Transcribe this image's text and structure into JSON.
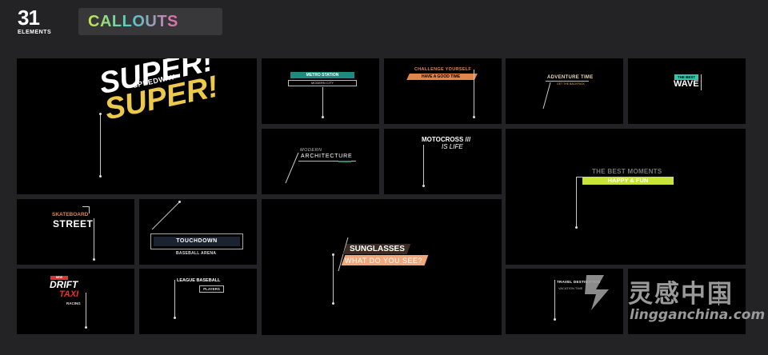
{
  "header": {
    "count": "31",
    "count_label": "ELEMENTS",
    "category": "CALLOUTS"
  },
  "callouts": {
    "super": {
      "top": "SUPER!",
      "middle": "SPEEDWAY",
      "bottom": "SUPER!"
    },
    "metro": {
      "title": "METRO STATION",
      "sub": "MODERN CITY"
    },
    "challenge": {
      "title": "CHALLENGE YOURSELF",
      "sub": "HAVE A GOOD TIME"
    },
    "adventure": {
      "title": "ADVENTURE TIME",
      "sub": "GET THE BACKPACK"
    },
    "wave": {
      "top": "THE BEST",
      "bottom": "WAVE"
    },
    "modern": {
      "top": "MODERN",
      "bottom": "ARCHITECTURE"
    },
    "motocross": {
      "top": "MOTOCROSS ///",
      "bottom": "IS LIFE"
    },
    "moments": {
      "top": "THE BEST MOMENTS",
      "bottom": "HAPPY & FUN"
    },
    "skateboard": {
      "top": "SKATEBOARD",
      "bottom": "STREET"
    },
    "touchdown": {
      "title": "TOUCHDOWN",
      "sub": "BASEBALL ARENA"
    },
    "sunglasses": {
      "top": "SUNGLASSES",
      "bottom": "WHAT DO YOU SEE?"
    },
    "drift": {
      "tag": "NEW",
      "top": "DRIFT",
      "middle": "TAXI",
      "bottom": "RACING"
    },
    "baseball": {
      "top": "LEAGUE BASEBALL",
      "bottom": "PLAYERS"
    },
    "travel": {
      "top": "TRAVEL DESTINATION",
      "bottom": "VACATION TIME"
    }
  },
  "watermark": {
    "cn": "灵感中国",
    "en": "lingganchina.com"
  },
  "colors": {
    "teal": "#1f8a7e",
    "yellow": "#ecc94b",
    "lime": "#c8e33a",
    "peach": "#f4a77a",
    "red": "#e0342f",
    "orange": "#e0864a"
  }
}
